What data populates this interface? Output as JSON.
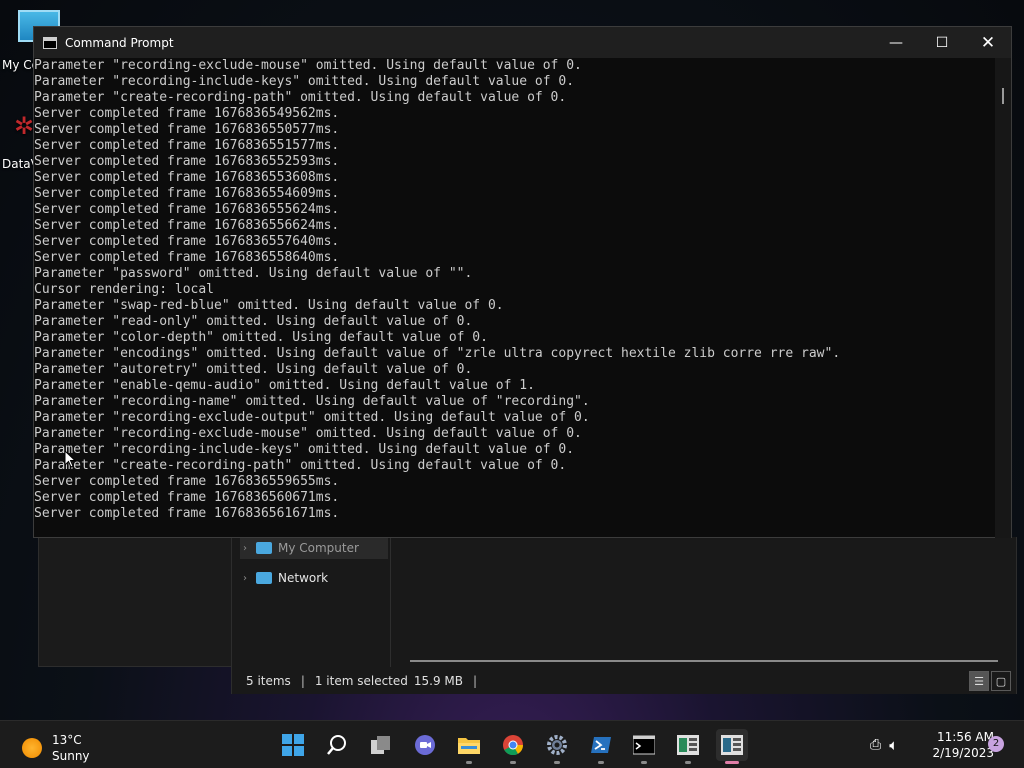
{
  "desktop": {
    "icons": [
      {
        "label": "My Co"
      },
      {
        "label": "DataV"
      }
    ]
  },
  "cmd": {
    "title": "Command Prompt",
    "lines": [
      "Parameter \"recording-exclude-mouse\" omitted. Using default value of 0.",
      "Parameter \"recording-include-keys\" omitted. Using default value of 0.",
      "Parameter \"create-recording-path\" omitted. Using default value of 0.",
      "Server completed frame 1676836549562ms.",
      "Server completed frame 1676836550577ms.",
      "Server completed frame 1676836551577ms.",
      "Server completed frame 1676836552593ms.",
      "Server completed frame 1676836553608ms.",
      "Server completed frame 1676836554609ms.",
      "Server completed frame 1676836555624ms.",
      "Server completed frame 1676836556624ms.",
      "Server completed frame 1676836557640ms.",
      "Server completed frame 1676836558640ms.",
      "Parameter \"password\" omitted. Using default value of \"\".",
      "Cursor rendering: local",
      "Parameter \"swap-red-blue\" omitted. Using default value of 0.",
      "Parameter \"read-only\" omitted. Using default value of 0.",
      "Parameter \"color-depth\" omitted. Using default value of 0.",
      "Parameter \"encodings\" omitted. Using default value of \"zrle ultra copyrect hextile zlib corre rre raw\".",
      "Parameter \"autoretry\" omitted. Using default value of 0.",
      "Parameter \"enable-qemu-audio\" omitted. Using default value of 1.",
      "Parameter \"recording-name\" omitted. Using default value of \"recording\".",
      "Parameter \"recording-exclude-output\" omitted. Using default value of 0.",
      "Parameter \"recording-exclude-mouse\" omitted. Using default value of 0.",
      "Parameter \"recording-include-keys\" omitted. Using default value of 0.",
      "Parameter \"create-recording-path\" omitted. Using default value of 0.",
      "Server completed frame 1676836559655ms.",
      "Server completed frame 1676836560671ms.",
      "Server completed frame 1676836561671ms."
    ]
  },
  "explorer": {
    "nav": [
      {
        "label": "My Computer"
      },
      {
        "label": "Network"
      }
    ],
    "status": {
      "items": "5 items",
      "selected": "1 item selected",
      "size": "15.9 MB"
    }
  },
  "taskbar": {
    "weather": {
      "temp": "13°C",
      "condition": "Sunny"
    },
    "apps": [
      {
        "name": "start-icon"
      },
      {
        "name": "search-icon"
      },
      {
        "name": "task-view-icon"
      },
      {
        "name": "chat-icon"
      },
      {
        "name": "file-explorer-icon"
      },
      {
        "name": "chrome-icon"
      },
      {
        "name": "settings-icon"
      },
      {
        "name": "powershell-icon"
      },
      {
        "name": "terminal-icon"
      },
      {
        "name": "app-icon"
      },
      {
        "name": "app-active-icon"
      }
    ],
    "time": "11:56 AM",
    "date": "2/19/2023",
    "notifications": "2"
  },
  "colors": {
    "console_text": "#cccccc",
    "console_bg": "#0c0c0c",
    "accent": "#e07ea8"
  }
}
